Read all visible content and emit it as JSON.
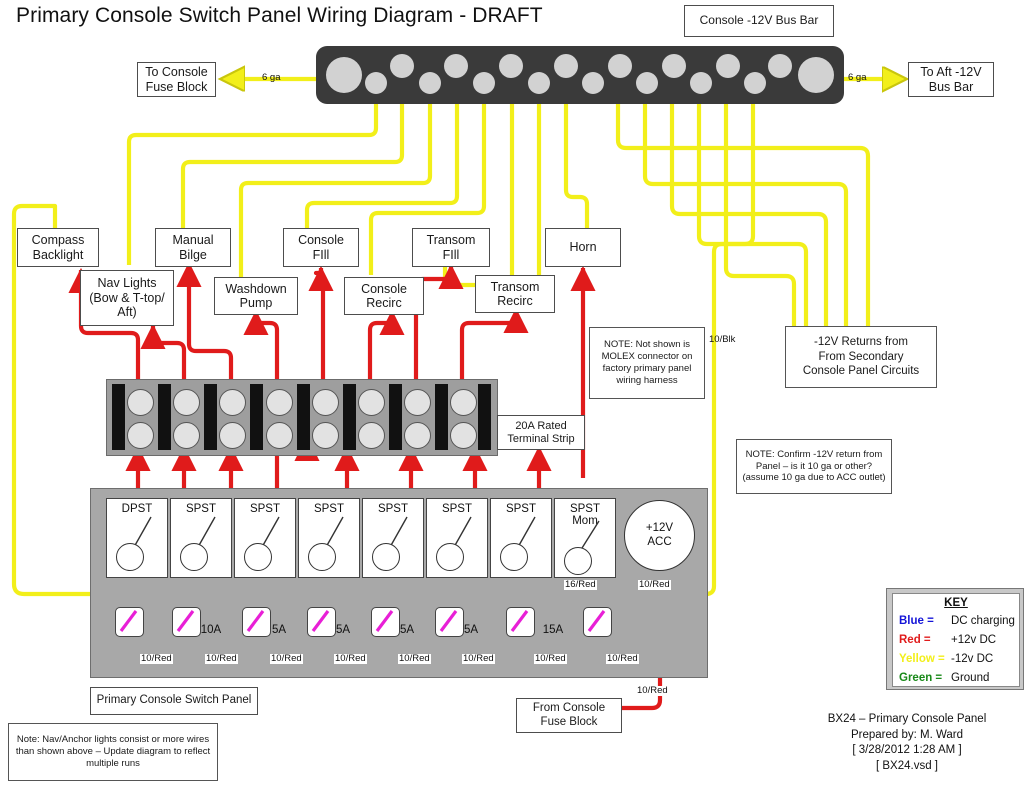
{
  "title": "Primary Console Switch Panel Wiring Diagram - DRAFT",
  "colors": {
    "yellow": "#f2ef1a",
    "red": "#e01b1b",
    "magenta": "#e81fd6",
    "bus_body": "#3a3a3a",
    "panel_body": "#a8a8a8",
    "strip_body": "#9e9e9e"
  },
  "busbar": {
    "caption": "Console -12V Bus Bar",
    "left_label": "To Console\nFuse Block",
    "left_label_l1": "To Console",
    "left_label_l2": "Fuse Block",
    "left_gauge": "6 ga",
    "right_label_l1": "To Aft -12V",
    "right_label_l2": "Bus Bar",
    "right_gauge": "6 ga"
  },
  "devices": [
    {
      "id": "compass-backlight",
      "l1": "Compass",
      "l2": "Backlight"
    },
    {
      "id": "nav-lights",
      "l1": "Nav Lights",
      "l2": "(Bow & T-top/",
      "l3": "Aft)"
    },
    {
      "id": "manual-bilge",
      "l1": "Manual",
      "l2": "Bilge"
    },
    {
      "id": "washdown-pump",
      "l1": "Washdown",
      "l2": "Pump"
    },
    {
      "id": "console-fill",
      "l1": "Console",
      "l2": "FIll"
    },
    {
      "id": "console-recirc",
      "l1": "Console",
      "l2": "Recirc"
    },
    {
      "id": "transom-fill",
      "l1": "Transom",
      "l2": "FIll"
    },
    {
      "id": "transom-recirc",
      "l1": "Transom",
      "l2": "Recirc"
    },
    {
      "id": "horn",
      "l1": "Horn",
      "l2": ""
    }
  ],
  "terminal_strip": {
    "label_l1": "20A Rated",
    "label_l2": "Terminal Strip",
    "pairs": 8
  },
  "switches": [
    {
      "type": "DPST",
      "sub": ""
    },
    {
      "type": "SPST",
      "sub": ""
    },
    {
      "type": "SPST",
      "sub": ""
    },
    {
      "type": "SPST",
      "sub": ""
    },
    {
      "type": "SPST",
      "sub": ""
    },
    {
      "type": "SPST",
      "sub": ""
    },
    {
      "type": "SPST",
      "sub": ""
    },
    {
      "type": "SPST",
      "sub": "Mom"
    }
  ],
  "acc_outlet": {
    "l1": "+12V",
    "l2": "ACC"
  },
  "fuses": [
    {
      "rating": "",
      "wire": "10/Red"
    },
    {
      "rating": "10A",
      "wire": "10/Red"
    },
    {
      "rating": "5A",
      "wire": "10/Red"
    },
    {
      "rating": "5A",
      "wire": "10/Red"
    },
    {
      "rating": "5A",
      "wire": "10/Red"
    },
    {
      "rating": "5A",
      "wire": "10/Red"
    },
    {
      "rating": "",
      "wire": "10/Red"
    },
    {
      "rating": "15A",
      "wire": "10/Red"
    }
  ],
  "wire_labels": {
    "mom_switch": "16/Red",
    "acc_feed": "10/Red",
    "blk_return": "10/Blk",
    "fuse_feed": "10/Red"
  },
  "notes": {
    "molex": "NOTE: Not shown is MOLEX connector on factory primary panel wiring harness",
    "returns_l1": "-12V Returns from",
    "returns_l2": "From Secondary",
    "returns_l3": "Console Panel Circuits",
    "confirm": "NOTE: Confirm -12V return from Panel – is it 10 ga or other?  (assume 10 ga due to ACC outlet)",
    "nav_anchor": "Note: Nav/Anchor lights consist or more wires than shown above – Update diagram to reflect multiple runs"
  },
  "captions": {
    "panel": "Primary Console Switch Panel",
    "from_fuse_l1": "From  Console",
    "from_fuse_l2": "Fuse Block"
  },
  "key": {
    "title": "KEY",
    "rows": [
      {
        "name": "Blue =",
        "value": "DC charging",
        "color": "#1414d8"
      },
      {
        "name": "Red =",
        "value": "+12v DC",
        "color": "#e01b1b"
      },
      {
        "name": "Yellow =",
        "value": "-12v DC",
        "color": "#f2ef1a"
      },
      {
        "name": "Green =",
        "value": "Ground",
        "color": "#1a8a1a"
      }
    ]
  },
  "signature": {
    "l1": "BX24 – Primary Console Panel",
    "l2": "Prepared by: M. Ward",
    "l3": "[ 3/28/2012 1:28 AM ]",
    "l4": "[ BX24.vsd ]"
  }
}
